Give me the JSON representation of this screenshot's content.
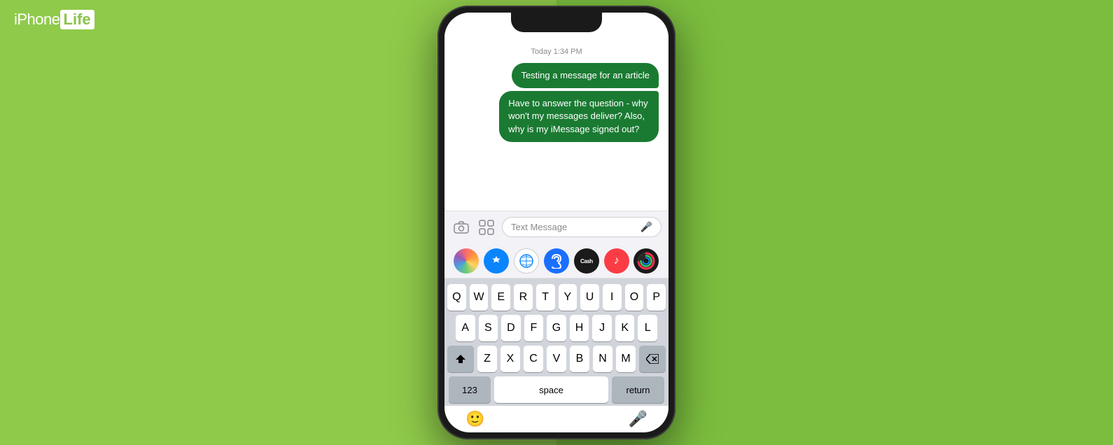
{
  "logo": {
    "iphone": "iPhone",
    "life": "Life"
  },
  "phone": {
    "timestamp": "Today 1:34 PM",
    "messages": [
      {
        "id": 1,
        "text": "Testing a message for an article",
        "style": "bubble-1"
      },
      {
        "id": 2,
        "text": "Have to answer the question - why won't my messages deliver? Also, why is my iMessage signed out?",
        "style": "bubble-2"
      }
    ],
    "input_placeholder": "Text Message",
    "app_icons": [
      {
        "name": "Photos",
        "class": "app-icon-photos",
        "symbol": ""
      },
      {
        "name": "App Store",
        "class": "app-icon-appstore",
        "symbol": "A"
      },
      {
        "name": "Safari",
        "class": "app-icon-safari",
        "symbol": "🌐"
      },
      {
        "name": "Shazam",
        "class": "app-icon-shazam",
        "symbol": ""
      },
      {
        "name": "Apple Cash",
        "class": "app-icon-cash",
        "symbol": "Cash"
      },
      {
        "name": "Music",
        "class": "app-icon-music",
        "symbol": "♪"
      },
      {
        "name": "Fitness",
        "class": "app-icon-fitness",
        "symbol": ""
      }
    ],
    "keyboard": {
      "row1": [
        "Q",
        "W",
        "E",
        "R",
        "T",
        "Y",
        "U",
        "I",
        "O",
        "P"
      ],
      "row2": [
        "A",
        "S",
        "D",
        "F",
        "G",
        "H",
        "J",
        "K",
        "L"
      ],
      "row3": [
        "Z",
        "X",
        "C",
        "V",
        "B",
        "N",
        "M"
      ],
      "bottom": {
        "numbers": "123",
        "space": "space",
        "return": "return"
      }
    }
  }
}
